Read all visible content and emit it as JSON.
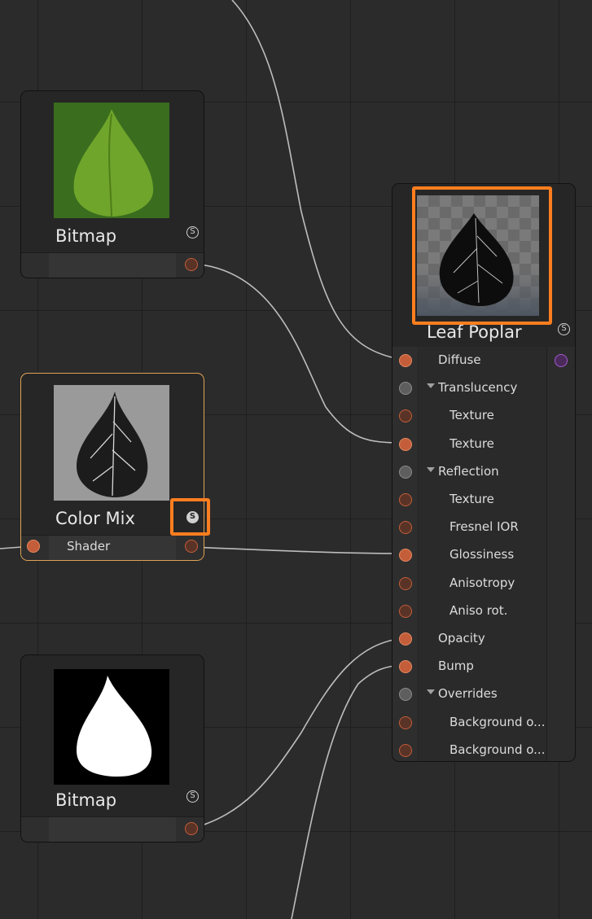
{
  "colors": {
    "accent_orange": "#ff7e1f",
    "port_orange": "#c45d39",
    "grid_bg": "#2b2b2b",
    "node_bg": "#262626",
    "selected_border": "#e0a255",
    "output_violet": "#a45ad0"
  },
  "nodes": {
    "bitmap_top": {
      "title": "Bitmap",
      "icon": "s-icon"
    },
    "color_mix": {
      "title": "Color Mix",
      "icon": "s-icon",
      "output_label": "Shader"
    },
    "bitmap_bottom": {
      "title": "Bitmap",
      "icon": "s-icon"
    },
    "material": {
      "title": "Leaf Poplar",
      "icon": "s-icon",
      "ports": [
        {
          "label": "Diffuse",
          "kind": "connected",
          "indent": 0
        },
        {
          "label": "Translucency",
          "kind": "group",
          "indent": 0
        },
        {
          "label": "Texture",
          "kind": "open",
          "indent": 1
        },
        {
          "label": "Texture",
          "kind": "connected",
          "indent": 1
        },
        {
          "label": "Reflection",
          "kind": "group",
          "indent": 0
        },
        {
          "label": "Texture",
          "kind": "open",
          "indent": 1
        },
        {
          "label": "Fresnel IOR",
          "kind": "open",
          "indent": 1
        },
        {
          "label": "Glossiness",
          "kind": "connected",
          "indent": 1
        },
        {
          "label": "Anisotropy",
          "kind": "open",
          "indent": 1
        },
        {
          "label": "Aniso rot.",
          "kind": "open",
          "indent": 1
        },
        {
          "label": "Opacity",
          "kind": "connected",
          "indent": 0
        },
        {
          "label": "Bump",
          "kind": "connected",
          "indent": 0
        },
        {
          "label": "Overrides",
          "kind": "group",
          "indent": 0
        },
        {
          "label": "Background o...",
          "kind": "open",
          "indent": 1
        },
        {
          "label": "Background o...",
          "kind": "open",
          "indent": 1
        }
      ]
    }
  }
}
